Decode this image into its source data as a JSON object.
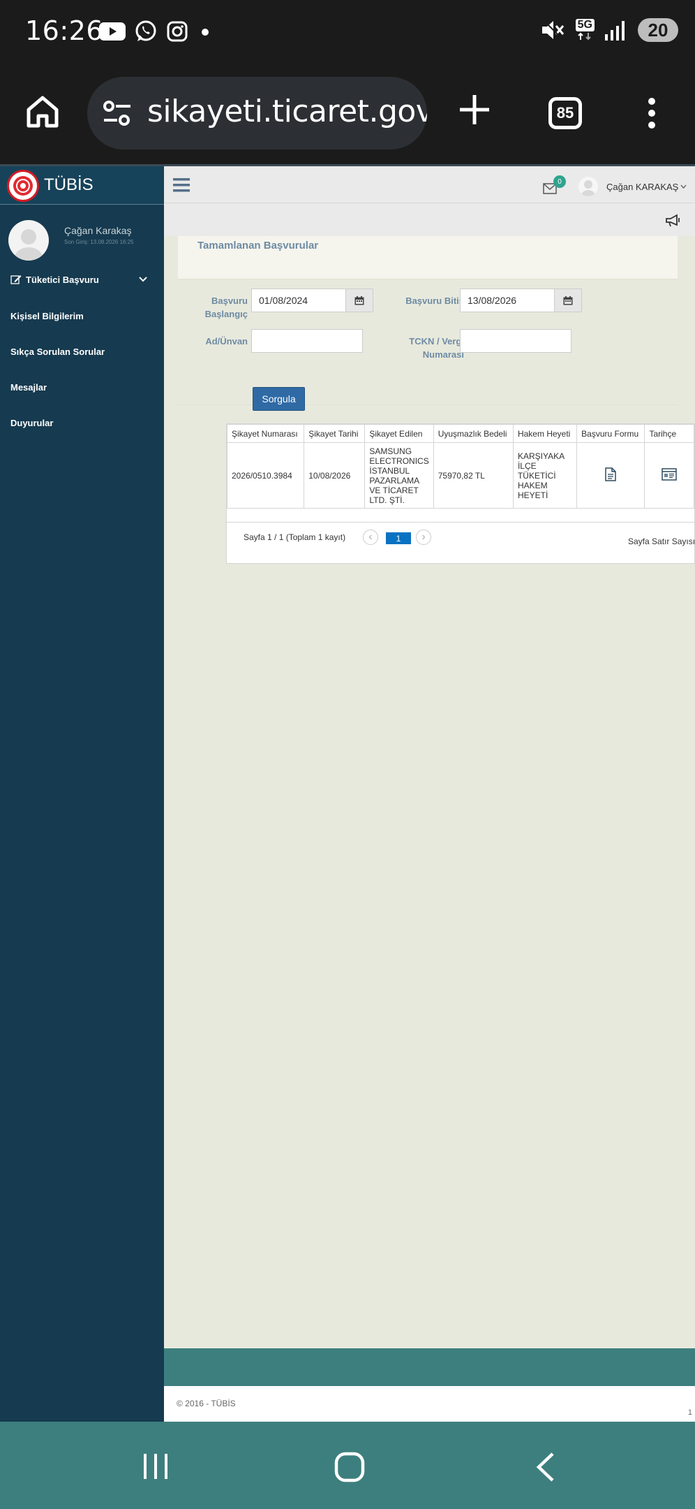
{
  "status_bar": {
    "time": "16:26",
    "network": "5G",
    "battery": "20",
    "left_icons": [
      "youtube-icon",
      "whatsapp-icon",
      "instagram-icon",
      "dot-icon"
    ],
    "right_icons": [
      "mute-icon",
      "5g-icon",
      "signal-icon",
      "battery-icon"
    ]
  },
  "browser": {
    "url": "sikayeti.ticaret.gov.tr",
    "tab_count": "85"
  },
  "app": {
    "brand": "TÜBİS",
    "user_name": "Çağan Karakaş",
    "last_login": "Son Giriş: 13.08.2026 16:25",
    "header_user": "Çağan KARAKAŞ",
    "mail_badge": "0"
  },
  "sidebar": {
    "items": [
      {
        "label": "Tüketici Başvuru"
      },
      {
        "label": "Kişisel Bilgilerim"
      },
      {
        "label": "Sıkça Sorulan Sorular"
      },
      {
        "label": "Mesajlar"
      },
      {
        "label": "Duyurular"
      }
    ]
  },
  "panel": {
    "title": "Tamamlanan Başvurular"
  },
  "form": {
    "start_label_1": "Başvuru",
    "start_label_2": "Başlangıç",
    "start_value": "01/08/2024",
    "end_label": "Başvuru Bitiş",
    "end_value": "13/08/2026",
    "name_label": "Ad/Ünvan",
    "name_value": "",
    "tckn_label_1": "TCKN / Vergi",
    "tckn_label_2": "Numarası",
    "tckn_value": "",
    "submit": "Sorgula"
  },
  "table": {
    "headers": [
      "Şikayet Numarası",
      "Şikayet Tarihi",
      "Şikayet Edilen",
      "Uyuşmazlık Bedeli",
      "Hakem Heyeti",
      "Başvuru Formu",
      "Tarihçe"
    ],
    "row": {
      "number": "2026/0510.3984",
      "date": "10/08/2026",
      "company": "SAMSUNG ELECTRONICS İSTANBUL PAZARLAMA VE TİCARET LTD. ŞTİ.",
      "amount": "75970,82 TL",
      "committee": "KARŞIYAKA İLÇE TÜKETİCİ HAKEM HEYETİ"
    },
    "pager_text": "Sayfa 1 / 1 (Toplam 1 kayıt)",
    "current_page": "1",
    "rows_label": "Sayfa Satır Sayısı"
  },
  "footer": {
    "copyright": "© 2016 - TÜBİS",
    "page_num": "1"
  },
  "colors": {
    "sidebar": "#163a4f",
    "accent_teal": "#3d7f7e",
    "button_blue": "#2f6aa5",
    "label_blue": "#6e8ba3"
  }
}
